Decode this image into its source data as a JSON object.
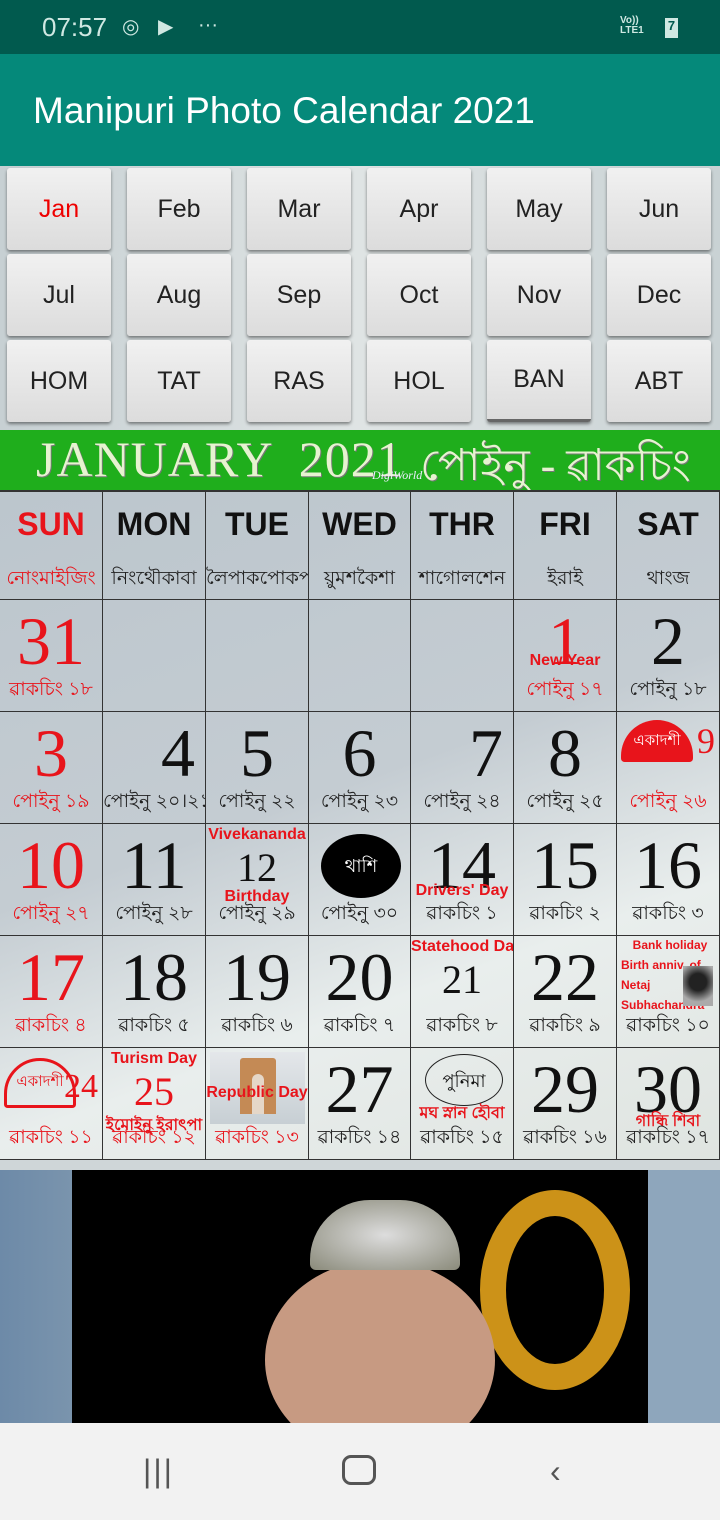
{
  "status_bar": {
    "time": "07:57",
    "network": "Vo)) LTE1",
    "battery": "7"
  },
  "app_bar": {
    "title": "Manipuri Photo Calendar 2021"
  },
  "month_buttons": [
    {
      "label": "Jan",
      "active": true
    },
    {
      "label": "Feb"
    },
    {
      "label": "Mar"
    },
    {
      "label": "Apr"
    },
    {
      "label": "May"
    },
    {
      "label": "Jun"
    },
    {
      "label": "Jul"
    },
    {
      "label": "Aug"
    },
    {
      "label": "Sep"
    },
    {
      "label": "Oct"
    },
    {
      "label": "Nov"
    },
    {
      "label": "Dec"
    },
    {
      "label": "HOM"
    },
    {
      "label": "TAT"
    },
    {
      "label": "RAS"
    },
    {
      "label": "HOL"
    },
    {
      "label": "BAN",
      "selected": true
    },
    {
      "label": "ABT"
    }
  ],
  "banner": {
    "english": "JANUARY  2021",
    "watermark": "DigiWorld",
    "manipuri": "পোইনু - ৱাকচিং"
  },
  "weekdays": [
    {
      "en": "SUN",
      "mn": "নোংমাইজিং",
      "red": true
    },
    {
      "en": "MON",
      "mn": "নিংথৌকাবা"
    },
    {
      "en": "TUE",
      "mn": "লৈপাকপোকপা"
    },
    {
      "en": "WED",
      "mn": "য়ুমশকৈশা"
    },
    {
      "en": "THR",
      "mn": "শাগোলশেন"
    },
    {
      "en": "FRI",
      "mn": "ইরাই"
    },
    {
      "en": "SAT",
      "mn": "থাংজ"
    }
  ],
  "weeks": [
    [
      {
        "day": "31",
        "red": true,
        "sub": "ৱাকচিং ১৮"
      },
      {},
      {},
      {},
      {},
      {
        "day": "1",
        "red": true,
        "notes_bottom": [
          "New Year"
        ],
        "sub": "পোইনু ১৭"
      },
      {
        "day": "2",
        "sub": "পোইনু ১৮"
      }
    ],
    [
      {
        "day": "3",
        "red": true,
        "sub": "পোইনু ১৯"
      },
      {
        "day": "4",
        "sub": "পোইনু ২০।২১"
      },
      {
        "day": "5",
        "sub": "পোইনু ২২"
      },
      {
        "day": "6",
        "sub": "পোইনু ২৩"
      },
      {
        "day": "7",
        "sub": "পোইনু ২৪"
      },
      {
        "day": "8",
        "sub": "পোইনু ২৫"
      },
      {
        "day": "9",
        "red": true,
        "badge": "একাদশী",
        "sub": "পোইনু ২৬"
      }
    ],
    [
      {
        "day": "10",
        "red": true,
        "sub": "পোইনু ২৭"
      },
      {
        "day": "11",
        "sub": "পোইনু ২৮"
      },
      {
        "day": "12",
        "small": true,
        "notes_top": [
          "Vivekananda"
        ],
        "notes_bottom": [
          "Birthday"
        ],
        "sub": "পোইনু ২৯"
      },
      {
        "circle": "থাশি",
        "circle_style": "black",
        "sub": "পোইনু ৩০"
      },
      {
        "day": "14",
        "notes_bottom": [
          "Drivers' Day"
        ],
        "sub": "ৱাকচিং ১"
      },
      {
        "day": "15",
        "sub": "ৱাকচিং ২"
      },
      {
        "day": "16",
        "sub": "ৱাকচিং ৩"
      }
    ],
    [
      {
        "day": "17",
        "red": true,
        "sub": "ৱাকচিং ৪"
      },
      {
        "day": "18",
        "sub": "ৱাকচিং ৫"
      },
      {
        "day": "19",
        "sub": "ৱাকচিং ৬"
      },
      {
        "day": "20",
        "sub": "ৱাকচিং ৭"
      },
      {
        "day": "21",
        "small": true,
        "notes_top": [
          "Statehood Day"
        ],
        "sub": "ৱাকচিং ৮"
      },
      {
        "day": "22",
        "sub": "ৱাকচিং ৯"
      },
      {
        "notes_list": [
          "Bank holiday",
          "Birth anniv. of",
          "Netaj",
          "Subhachandra"
        ],
        "photo": true,
        "sub": "ৱাকচিং ১০"
      }
    ],
    [
      {
        "day": "24",
        "red": true,
        "badge": "একাদশী",
        "badge_style": "outline",
        "sub": "ৱাকচিং ১১",
        "sub_red": true
      },
      {
        "day": "25",
        "red": true,
        "small": true,
        "notes_top": [
          "Turism Day"
        ],
        "notes_bottom": [
          "ইমোইনু ইরাৎপা"
        ],
        "sub": "ৱাকচিং ১২"
      },
      {
        "image": "india-gate",
        "notes_bottom": [
          "Republic Day"
        ],
        "sub": "ৱাকচিং ১৩",
        "sub_red": true
      },
      {
        "day": "27",
        "sub": "ৱাকচিং ১৪"
      },
      {
        "circle": "পুনিমা",
        "circle_style": "ring",
        "notes_bottom": [
          "মঘ স্নান হৌবা"
        ],
        "sub": "ৱাকচিং ১৫"
      },
      {
        "day": "29",
        "sub": "ৱাকচিং ১৬"
      },
      {
        "day": "30",
        "notes_bottom": [
          "গান্ধি শিবা"
        ],
        "sub": "ৱাকচিং ১৭"
      }
    ]
  ],
  "colors": {
    "status_bar": "#015a4e",
    "app_bar": "#05897a",
    "banner": "#1fae1c",
    "holiday_red": "#e8141b"
  },
  "nav": {
    "recent": "recent-apps-icon",
    "home": "home-icon",
    "back": "back-icon"
  }
}
